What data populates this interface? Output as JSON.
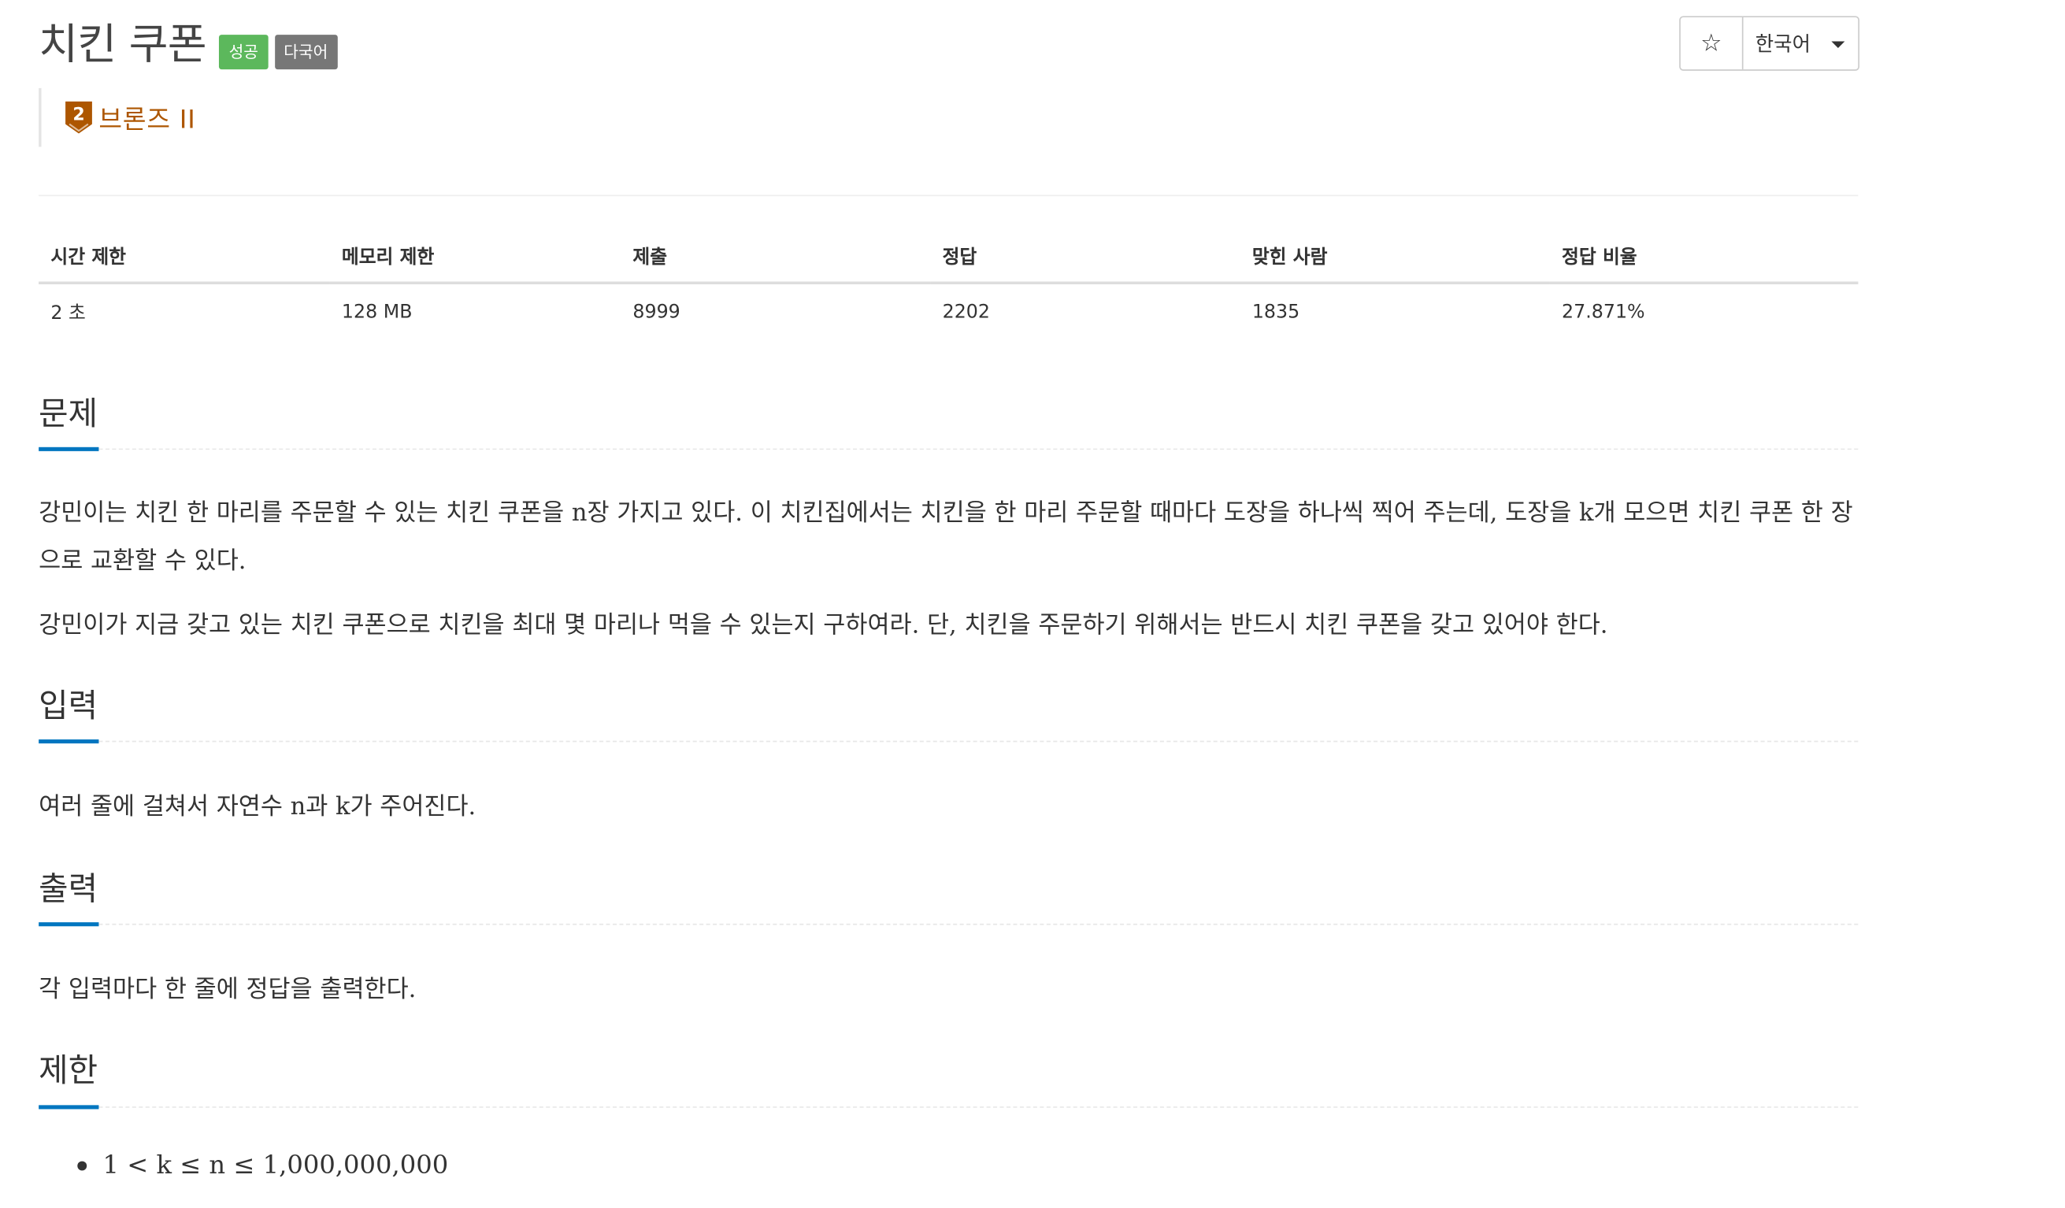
{
  "problem": {
    "title": "치킨 쿠폰",
    "labels": {
      "success": "성공",
      "multilang": "다국어"
    },
    "tier": {
      "number": "2",
      "text": "브론즈 II"
    }
  },
  "toolbar": {
    "star_icon": "☆",
    "language": "한국어"
  },
  "info_table": {
    "headers": [
      "시간 제한",
      "메모리 제한",
      "제출",
      "정답",
      "맞힌 사람",
      "정답 비율"
    ],
    "values": [
      "2 초",
      "128 MB",
      "8999",
      "2202",
      "1835",
      "27.871%"
    ]
  },
  "sections": {
    "problem": {
      "heading": "문제",
      "paragraphs": [
        "강민이는 치킨 한 마리를 주문할 수 있는 치킨 쿠폰을 n장 가지고 있다. 이 치킨집에서는 치킨을 한 마리 주문할 때마다 도장을 하나씩 찍어 주는데, 도장을 k개 모으면 치킨 쿠폰 한 장으로 교환할 수 있다.",
        "강민이가 지금 갖고 있는 치킨 쿠폰으로 치킨을 최대 몇 마리나 먹을 수 있는지 구하여라. 단, 치킨을 주문하기 위해서는 반드시 치킨 쿠폰을 갖고 있어야 한다."
      ]
    },
    "input": {
      "heading": "입력",
      "text": "여러 줄에 걸쳐서 자연수 n과 k가 주어진다."
    },
    "output": {
      "heading": "출력",
      "text": "각 입력마다 한 줄에 정답을 출력한다."
    },
    "limit": {
      "heading": "제한",
      "items": [
        "1 < k ≤ n ≤ 1,000,000,000"
      ]
    }
  },
  "colors": {
    "success": "#5cb85c",
    "default": "#777777",
    "tier": "#ad5600",
    "accent": "#0076c0"
  }
}
